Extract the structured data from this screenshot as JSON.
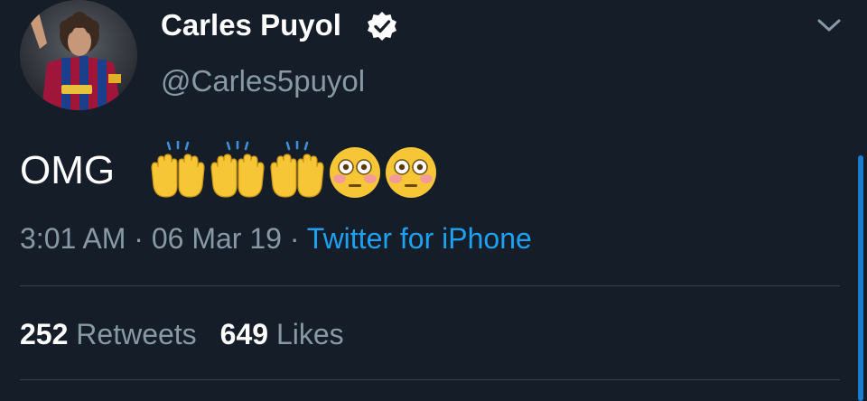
{
  "tweet": {
    "author": {
      "display_name": "Carles Puyol",
      "handle": "@Carles5puyol",
      "verified": true
    },
    "text": "OMG",
    "emojis": [
      "raising-hands",
      "raising-hands",
      "raising-hands",
      "flushed-face",
      "flushed-face"
    ],
    "time": "3:01 AM",
    "date": "06 Mar 19",
    "separator": "·",
    "source": "Twitter for iPhone",
    "retweets_count": "252",
    "retweets_label": "Retweets",
    "likes_count": "649",
    "likes_label": "Likes"
  },
  "colors": {
    "background": "#151d28",
    "secondary_text": "#8899a6",
    "link": "#1da1f2",
    "divider": "#38444d",
    "emoji_yellow": "#f7c637"
  },
  "icons": {
    "verified": "verified-badge-icon",
    "menu": "chevron-down-icon"
  }
}
